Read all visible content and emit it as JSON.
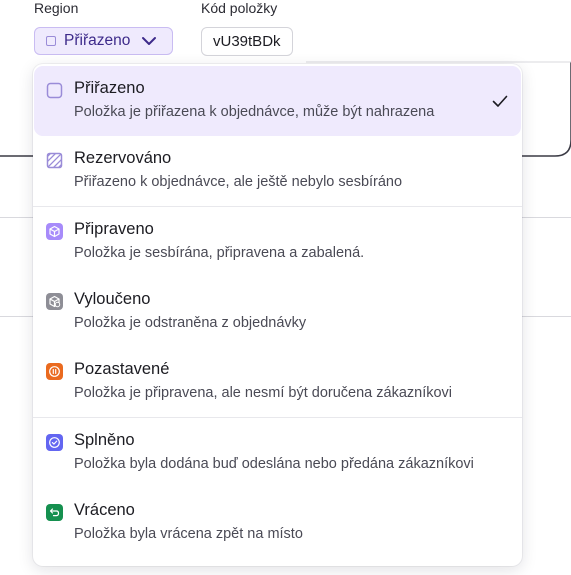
{
  "fields": {
    "region_label": "Region",
    "code_label": "Kód položky",
    "region_value": "Přiřazeno",
    "code_value": "vU39tBDk"
  },
  "colors": {
    "accent": "#3d2a8a",
    "selected_bg": "#efeafd",
    "prepared": "#a78bfa",
    "excluded": "#8e8e96",
    "paused": "#ea6a1f",
    "fulfilled": "#6366f1",
    "returned": "#15904f"
  },
  "options": [
    {
      "title": "Přiřazeno",
      "desc": "Položka je přiřazena k objednávce, může být nahrazena",
      "icon": "assigned-icon"
    },
    {
      "title": "Rezervováno",
      "desc": "Přiřazeno k objednávce, ale ještě nebylo sesbíráno",
      "icon": "reserved-icon"
    },
    {
      "title": "Připraveno",
      "desc": "Položka je sesbírána, připravena a zabalená.",
      "icon": "package-icon"
    },
    {
      "title": "Vyloučeno",
      "desc": "Položka je odstraněna z objednávky",
      "icon": "package-excluded-icon"
    },
    {
      "title": "Pozastavené",
      "desc": "Položka je připravena, ale nesmí být doručena zákazníkovi",
      "icon": "pause-icon"
    },
    {
      "title": "Splněno",
      "desc": "Položka byla dodána buď odeslána nebo předána zákazníkovi",
      "icon": "check-circle-icon"
    },
    {
      "title": "Vráceno",
      "desc": "Položka byla vrácena zpět na místo",
      "icon": "return-icon"
    }
  ]
}
